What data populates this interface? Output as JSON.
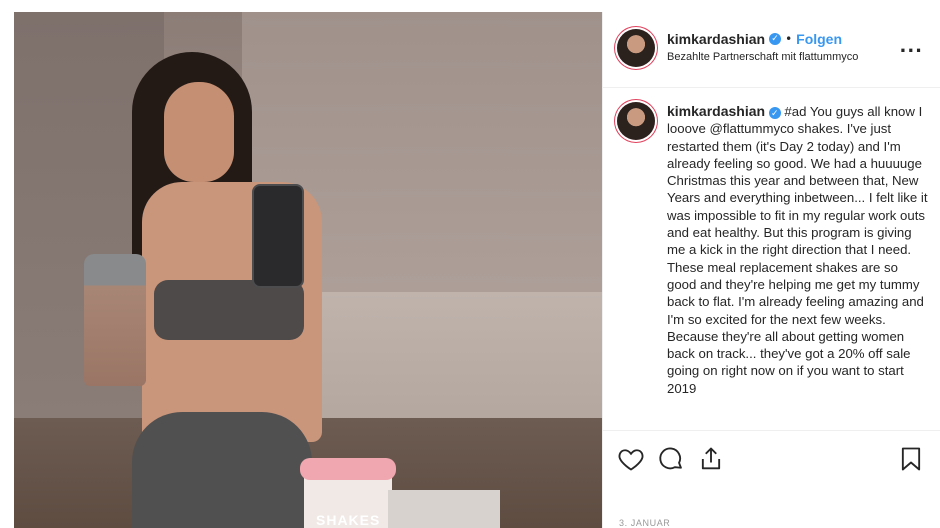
{
  "post": {
    "photo": {
      "product_label": "SHAKES"
    }
  },
  "header": {
    "username": "kimkardashian",
    "verified_icon": "verified-badge-icon",
    "separator": "•",
    "follow_label": "Folgen",
    "partnership": "Bezahlte Partnerschaft mit flattummyco",
    "more_label": "..."
  },
  "caption": {
    "username": "kimkardashian",
    "text": "#ad You guys all know I looove @flattummyco shakes. I've just restarted them (it's Day 2 today) and I'm already feeling so good. We had a huuuuge Christmas this year and between that, New Years and everything inbetween... I felt like it was impossible to fit in my regular work outs and eat healthy. But this program is giving me a kick in the right direction that I need. These meal replacement shakes are so good and they're helping me get my tummy back to flat. I'm already feeling amazing and I'm so excited for the next few weeks. Because they're all about getting women back on track... they've got a 20% off sale going on right now on if you want to start 2019"
  },
  "actions": {
    "like_icon": "heart-icon",
    "comment_icon": "comment-icon",
    "share_icon": "share-icon",
    "save_icon": "bookmark-icon"
  },
  "date": "3. JANUAR",
  "colors": {
    "accent": "#3897f0",
    "text": "#262626",
    "border": "#efefef"
  }
}
